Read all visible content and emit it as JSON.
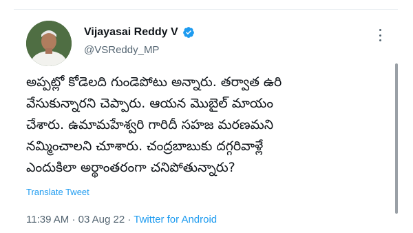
{
  "tweet": {
    "author": {
      "display_name": "Vijayasai Reddy V",
      "handle": "@VSReddy_MP",
      "verified": true
    },
    "text_lines": [
      "అప్పట్లో కోడెలది గుండెపోటు అన్నారు. తర్వాత ఉరి",
      "వేసుకున్నారని చెప్పారు. ఆయన మొబైల్ మాయం",
      "చేశారు. ఉమామహేశ్వరి గారిదీ సహజ మరణమని",
      "నమ్మించాలని చూశారు. చంద్రబాబుకు దగ్గరివాళ్లే",
      "ఎందుకిలా అర్థాంతరంగా చనిపోతున్నారు?"
    ],
    "translate_label": "Translate Tweet",
    "time": "11:39 AM",
    "separator": "·",
    "date": "03 Aug 22",
    "source": "Twitter for Android"
  },
  "colors": {
    "accent": "#1d9bf0",
    "secondary_text": "#536471",
    "primary_text": "#0f1419"
  },
  "icons": {
    "verified": "verified-badge-icon",
    "more": "more-options-icon"
  }
}
